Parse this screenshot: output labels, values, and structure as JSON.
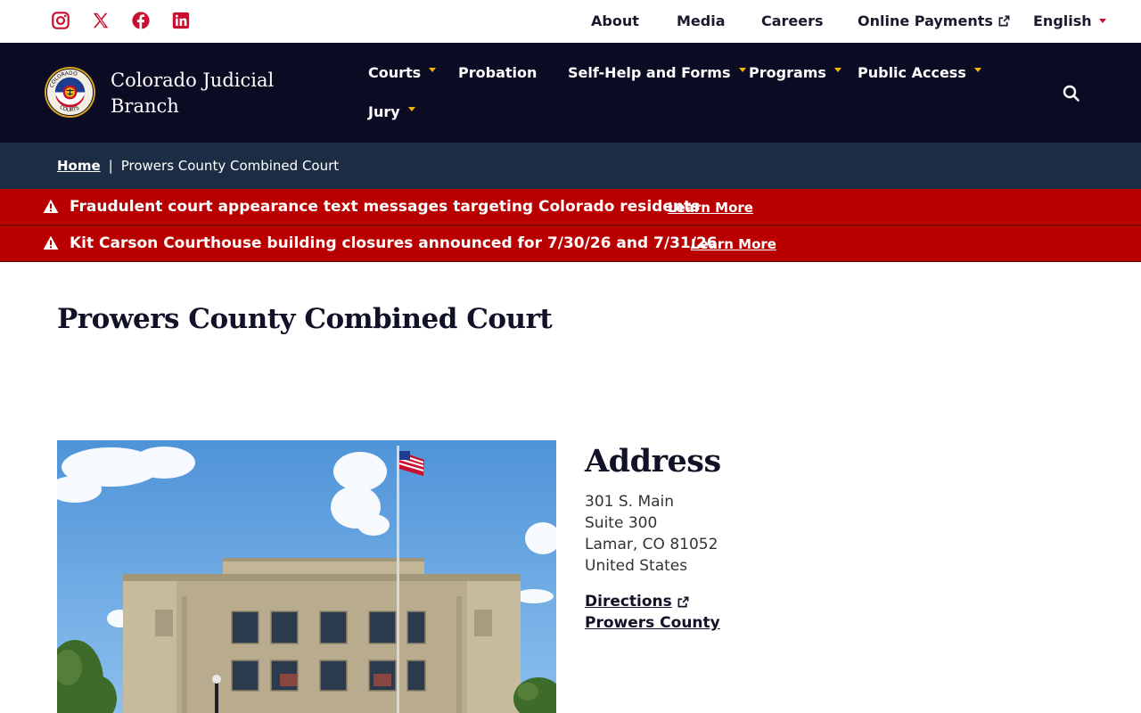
{
  "colors": {
    "nav_bg": "#0b0b24",
    "breadcrumb_bg": "#1b2c44",
    "alert_bg": "#b80000",
    "accent_gold": "#f2b705",
    "social_red": "#c8102e"
  },
  "social": [
    {
      "icon": "instagram-icon"
    },
    {
      "icon": "x-twitter-icon"
    },
    {
      "icon": "facebook-icon"
    },
    {
      "icon": "linkedin-icon"
    }
  ],
  "utility_nav": {
    "about": "About",
    "media": "Media",
    "careers": "Careers",
    "online_payments": "Online Payments",
    "language": "English"
  },
  "header": {
    "brand": "Colorado Judicial Branch",
    "logo_lettering": "COLORADO COURTS",
    "nav": {
      "courts": "Courts",
      "probation": "Probation",
      "self_help": "Self-Help and Forms",
      "programs": "Programs",
      "public_access": "Public Access",
      "jury": "Jury"
    }
  },
  "breadcrumb": {
    "home": "Home",
    "separator": "|",
    "current": "Prowers County Combined Court"
  },
  "alerts": [
    {
      "message": "Fraudulent court appearance text messages targeting Colorado residents",
      "link": "Learn More"
    },
    {
      "message": "Kit Carson Courthouse building closures announced for 7/30/26 and 7/31/26",
      "link": "Learn More"
    }
  ],
  "main": {
    "title": "Prowers County Combined Court",
    "address": {
      "heading": "Address",
      "line1": "301 S. Main",
      "line2": "Suite 300",
      "line3": "Lamar, CO 81052",
      "line4": "United States",
      "directions": "Directions",
      "county": "Prowers County"
    }
  }
}
